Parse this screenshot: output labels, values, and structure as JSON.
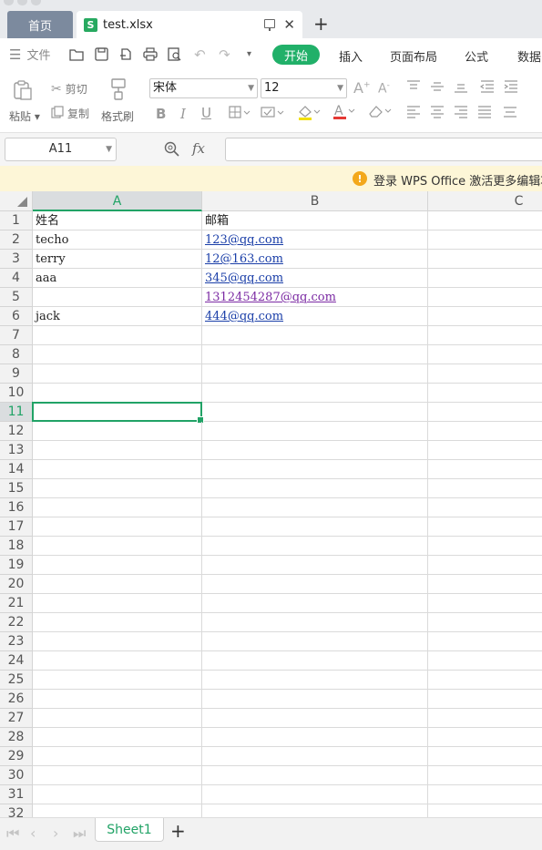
{
  "tabs": {
    "home": "首页",
    "file": "test.xlsx",
    "file_icon": "S"
  },
  "menu": {
    "file_label": "文件",
    "start": "开始",
    "insert": "插入",
    "page_layout": "页面布局",
    "formula": "公式",
    "data": "数据"
  },
  "ribbon": {
    "cut": "剪切",
    "paste": "粘贴",
    "copy": "复制",
    "format_painter": "格式刷",
    "font_name": "宋体",
    "font_size": "12"
  },
  "formula_bar": {
    "name_box": "A11",
    "fx": "fx",
    "value": ""
  },
  "notice": {
    "text": "登录 WPS Office 激活更多编辑功"
  },
  "sheet": {
    "columns": [
      "A",
      "B",
      "C"
    ],
    "active_column": "A",
    "active_row": 11,
    "rows": [
      {
        "n": "1",
        "a": "姓名",
        "b": "邮箱"
      },
      {
        "n": "2",
        "a": "techo",
        "b": "123@qq.com"
      },
      {
        "n": "3",
        "a": "terry",
        "b": "12@163.com"
      },
      {
        "n": "4",
        "a": "aaa",
        "b": "345@qq.com"
      },
      {
        "n": "5",
        "a": "",
        "b": "1312454287@qq.com"
      },
      {
        "n": "6",
        "a": "jack",
        "b": "444@qq.com"
      },
      {
        "n": "7",
        "a": "",
        "b": ""
      },
      {
        "n": "8",
        "a": "",
        "b": ""
      },
      {
        "n": "9",
        "a": "",
        "b": ""
      },
      {
        "n": "10",
        "a": "",
        "b": ""
      },
      {
        "n": "11",
        "a": "",
        "b": ""
      },
      {
        "n": "12",
        "a": "",
        "b": ""
      },
      {
        "n": "13",
        "a": "",
        "b": ""
      },
      {
        "n": "14",
        "a": "",
        "b": ""
      },
      {
        "n": "15",
        "a": "",
        "b": ""
      },
      {
        "n": "16",
        "a": "",
        "b": ""
      },
      {
        "n": "17",
        "a": "",
        "b": ""
      },
      {
        "n": "18",
        "a": "",
        "b": ""
      },
      {
        "n": "19",
        "a": "",
        "b": ""
      },
      {
        "n": "20",
        "a": "",
        "b": ""
      },
      {
        "n": "21",
        "a": "",
        "b": ""
      },
      {
        "n": "22",
        "a": "",
        "b": ""
      },
      {
        "n": "23",
        "a": "",
        "b": ""
      },
      {
        "n": "24",
        "a": "",
        "b": ""
      },
      {
        "n": "25",
        "a": "",
        "b": ""
      },
      {
        "n": "26",
        "a": "",
        "b": ""
      },
      {
        "n": "27",
        "a": "",
        "b": ""
      },
      {
        "n": "28",
        "a": "",
        "b": ""
      },
      {
        "n": "29",
        "a": "",
        "b": ""
      },
      {
        "n": "30",
        "a": "",
        "b": ""
      },
      {
        "n": "31",
        "a": "",
        "b": ""
      },
      {
        "n": "32",
        "a": "",
        "b": ""
      }
    ]
  },
  "sheet_tabs": {
    "active": "Sheet1"
  },
  "colors": {
    "accent": "#21a366",
    "start_button": "#21b069",
    "link": "#1a3ea8",
    "notice_bg": "#fdf6d7"
  }
}
